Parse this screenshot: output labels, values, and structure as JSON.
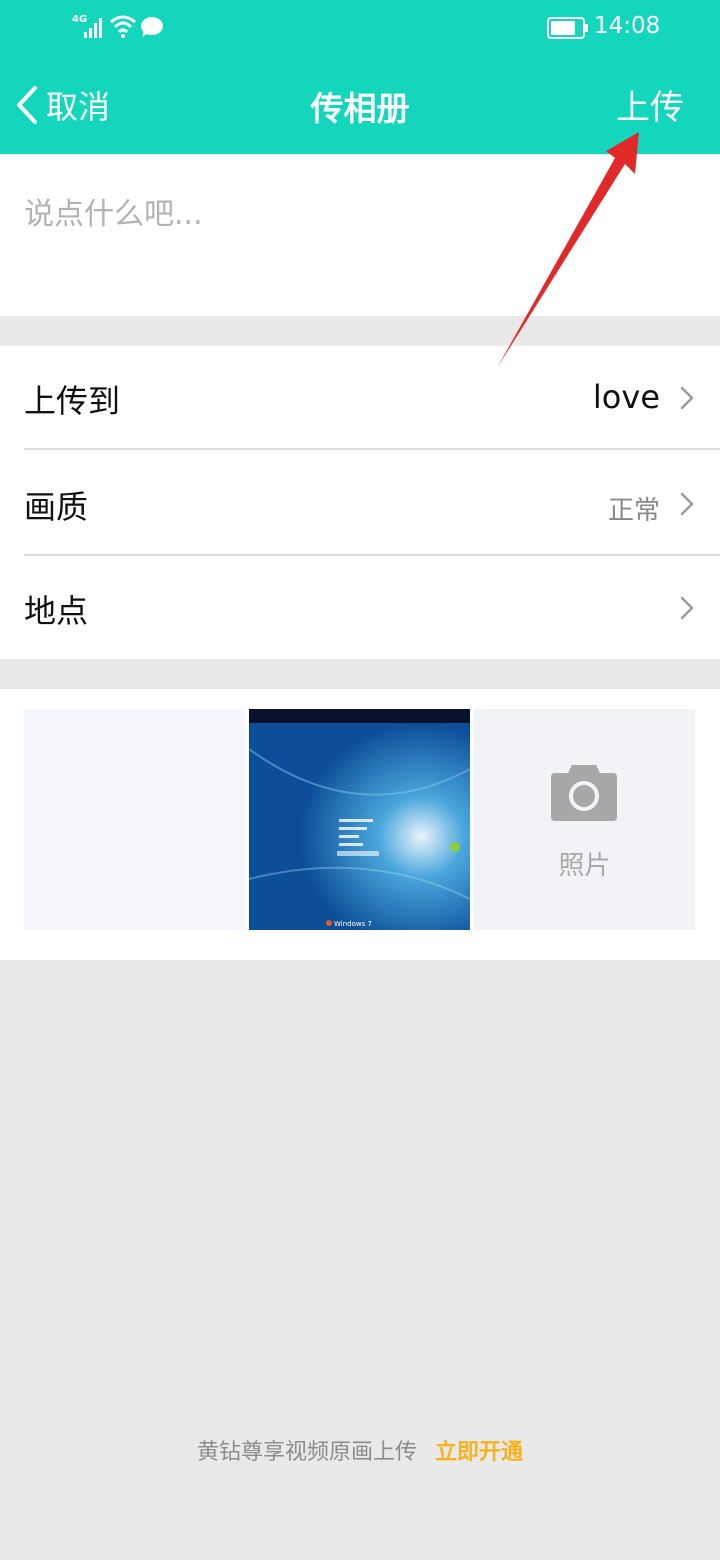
{
  "status_bar": {
    "network_label": "4G",
    "time": "14:08"
  },
  "nav": {
    "back_label": "取消",
    "title": "传相册",
    "upload_label": "上传"
  },
  "compose": {
    "placeholder": "说点什么吧..."
  },
  "settings": {
    "rows": [
      {
        "label": "上传到",
        "value": "love"
      },
      {
        "label": "画质",
        "value": "正常"
      },
      {
        "label": "地点",
        "value": ""
      }
    ]
  },
  "photos": {
    "add_label": "照片",
    "thumbnail_caption": "Windows 7"
  },
  "promo": {
    "text": "黄钻尊享视频原画上传",
    "link": "立即开通"
  },
  "colors": {
    "header": "#14d6bc",
    "promo_link": "#f5b21f",
    "annotation_arrow": "#e02a2a"
  }
}
